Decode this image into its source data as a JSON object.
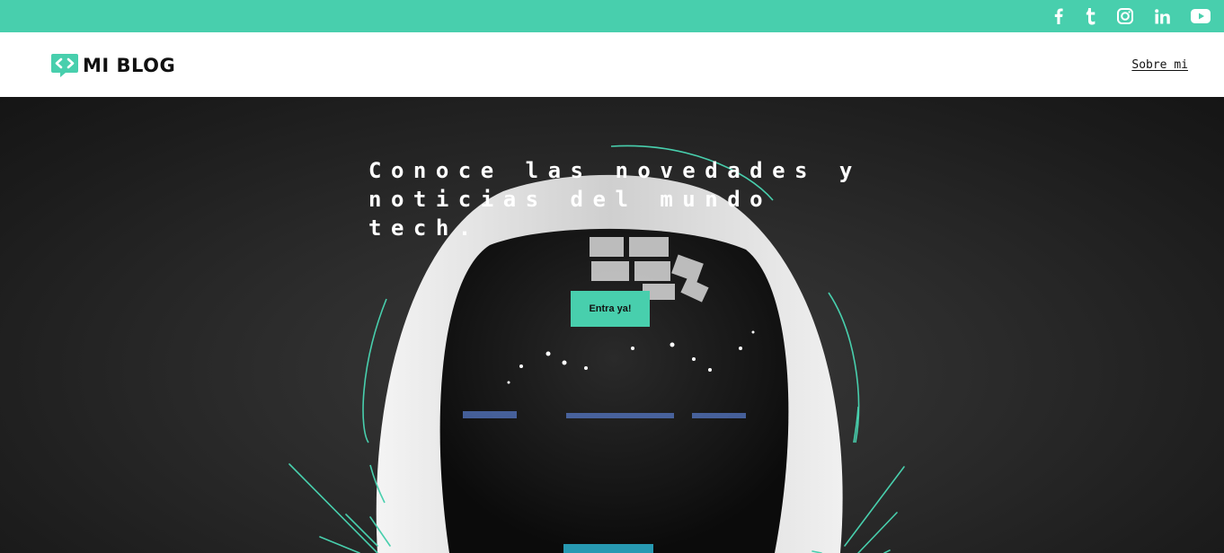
{
  "colors": {
    "accent": "#48cfad",
    "header_bg": "#ffffff",
    "hero_text": "#ffffff",
    "dark_text": "#111111"
  },
  "topbar": {
    "social": [
      {
        "icon": "facebook-icon"
      },
      {
        "icon": "tumblr-icon"
      },
      {
        "icon": "instagram-icon"
      },
      {
        "icon": "linkedin-icon"
      },
      {
        "icon": "youtube-icon"
      }
    ]
  },
  "header": {
    "logo_icon": "chat-code-icon",
    "logo_text": "MI BLOG",
    "nav": {
      "about_label": "Sobre mi"
    }
  },
  "hero": {
    "title": "Conoce las novedades y noticias del mundo tech.",
    "cta_label": "Entra ya!",
    "background": "astronaut-helmet-photo"
  }
}
